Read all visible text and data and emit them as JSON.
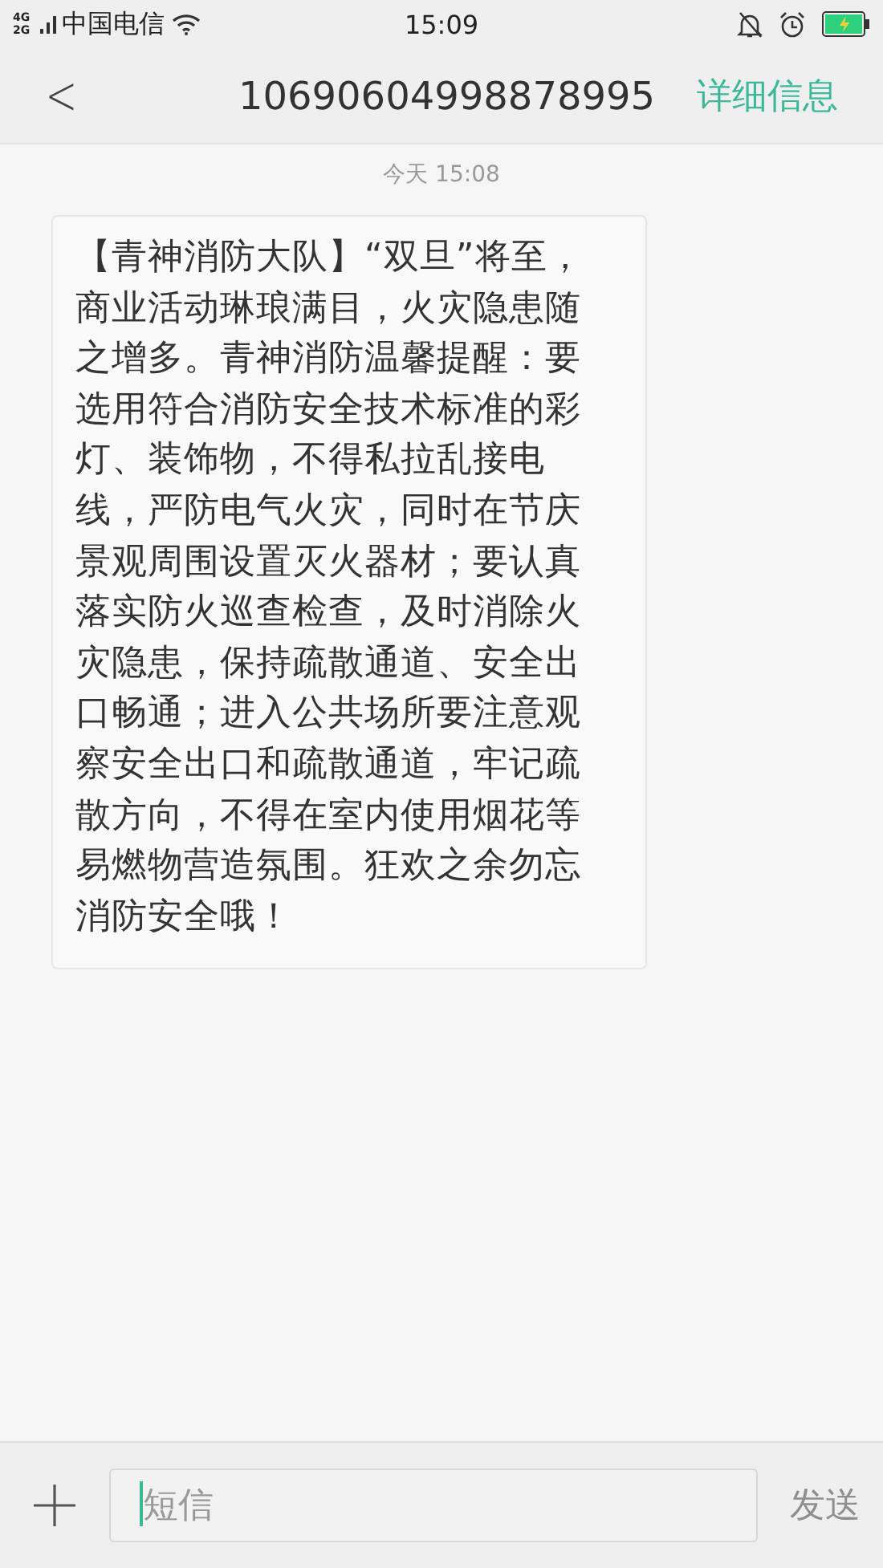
{
  "status_bar": {
    "network": [
      "4G",
      "2G"
    ],
    "carrier": "中国电信",
    "time": "15:09"
  },
  "header": {
    "back": "<",
    "title": "10690604998878995",
    "action": "详细信息"
  },
  "messages": [
    {
      "timestamp": "今天 15:08",
      "text": "【青神消防大队】“双旦”将至，商业活动琳琅满目，火灾隐患随之增多。青神消防温馨提醒：要选用符合消防安全技术标准的彩灯、装饰物，不得私拉乱接电线，严防电气火灾，同时在节庆景观周围设置灭火器材；要认真落实防火巡查检查，及时消除火灾隐患，保持疏散通道、安全出口畅通；进入公共场所要注意观察安全出口和疏散通道，牢记疏散方向，不得在室内使用烟花等易燃物营造氛围。狂欢之余勿忘消防安全哦！"
    }
  ],
  "composer": {
    "placeholder": "短信",
    "send": "发送",
    "send_disabled": true
  }
}
